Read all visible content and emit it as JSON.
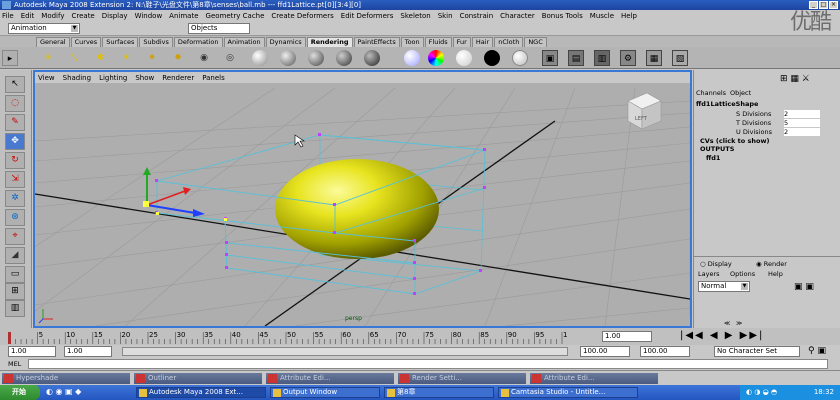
{
  "window": {
    "title": "Autodesk Maya 2008 Extension 2: N:\\鞋子\\光盘文件\\第8章\\senses\\ball.mb  ---  ffd1Lattice.pt[0][3:4][0]"
  },
  "menubar": {
    "items": [
      "File",
      "Edit",
      "Modify",
      "Create",
      "Display",
      "Window",
      "Animate",
      "Geometry Cache",
      "Create Deformers",
      "Edit Deformers",
      "Skeleton",
      "Skin",
      "Constrain",
      "Character",
      "Bonus Tools",
      "Muscle",
      "Help"
    ]
  },
  "status": {
    "mode": "Animation",
    "selection_mode": "Objects"
  },
  "shelf": {
    "tabs": [
      "General",
      "Curves",
      "Surfaces",
      "Subdivs",
      "Deformation",
      "Animation",
      "Dynamics",
      "Rendering",
      "PaintEffects",
      "Toon",
      "Fluids",
      "Fur",
      "Hair",
      "nCloth",
      "NGC"
    ],
    "active": "Rendering"
  },
  "viewport": {
    "menu": [
      "View",
      "Shading",
      "Lighting",
      "Show",
      "Renderer",
      "Panels"
    ],
    "camera": "persp",
    "cube_label": "LEFT"
  },
  "channelbox": {
    "tabs": [
      "Channels",
      "Object"
    ],
    "node": "ffd1LatticeShape",
    "attrs": [
      {
        "name": "S Divisions",
        "value": "2"
      },
      {
        "name": "T Divisions",
        "value": "5"
      },
      {
        "name": "U Divisions",
        "value": "2"
      }
    ],
    "cvs_label": "CVs (click to show)",
    "outputs_label": "OUTPUTS",
    "output_node": "ffd1",
    "display_label": "Display",
    "render_label": "Render",
    "layer_menu": [
      "Layers",
      "Options",
      "Help"
    ],
    "layer_mode": "Normal"
  },
  "timeslider": {
    "ticks": [
      "5",
      "10",
      "15",
      "20",
      "25",
      "30",
      "35",
      "40",
      "45",
      "50",
      "55",
      "60",
      "65",
      "70",
      "75",
      "80",
      "85",
      "90",
      "95",
      "1"
    ],
    "current_frame": "1.00"
  },
  "range": {
    "start": "1.00",
    "start2": "1.00",
    "end": "100.00",
    "end2": "100.00",
    "char_set": "No Character Set"
  },
  "cmdline": {
    "label": "MEL"
  },
  "floatwins": [
    "Hypershade",
    "Outliner",
    "Attribute Edi...",
    "Render Setti...",
    "Attribute Edi..."
  ],
  "taskbar": {
    "start": "开始",
    "tasks": [
      "Autodesk Maya 2008 Ext...",
      "Output Window",
      "第8章",
      "Camtasia Studio - Untitle..."
    ],
    "clock": "18:32"
  },
  "watermark": "优酷"
}
